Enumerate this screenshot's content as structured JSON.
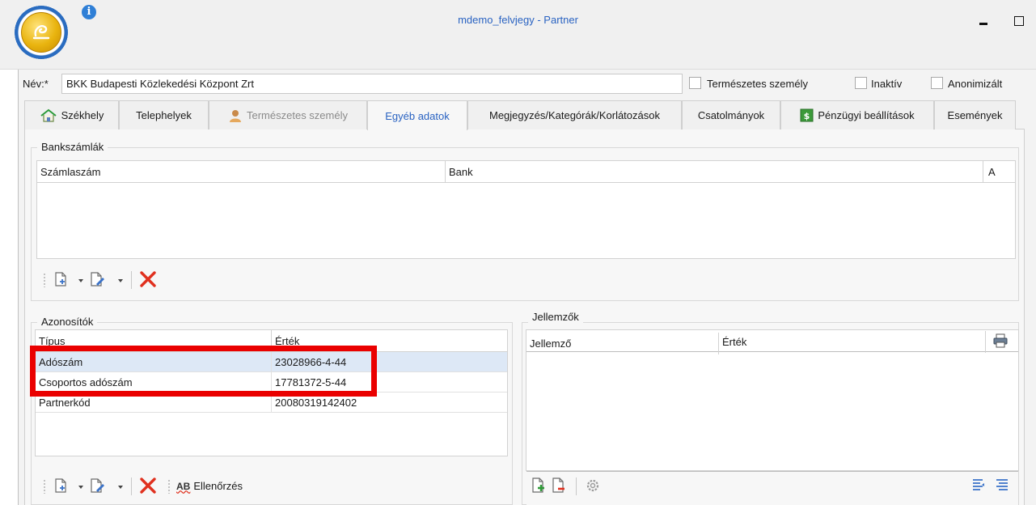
{
  "window": {
    "title": "mdemo_felvjegy - Partner"
  },
  "form": {
    "name_label": "Név:*",
    "name_value": "BKK Budapesti Közlekedési Központ Zrt",
    "natural_person_label": "Természetes személy",
    "inactive_label": "Inaktív",
    "anonymized_label": "Anonimizált"
  },
  "tabs": [
    {
      "label": "Székhely",
      "icon": "home-icon",
      "state": "normal"
    },
    {
      "label": "Telephelyek",
      "icon": "",
      "state": "normal"
    },
    {
      "label": "Természetes személy",
      "icon": "person-icon",
      "state": "disabled"
    },
    {
      "label": "Egyéb adatok",
      "icon": "",
      "state": "active"
    },
    {
      "label": "Megjegyzés/Kategórák/Korlátozások",
      "icon": "",
      "state": "normal"
    },
    {
      "label": "Csatolmányok",
      "icon": "",
      "state": "normal"
    },
    {
      "label": "Pénzügyi beállítások",
      "icon": "money-icon",
      "state": "normal"
    },
    {
      "label": "Események",
      "icon": "",
      "state": "normal"
    }
  ],
  "bank_accounts": {
    "title": "Bankszámlák",
    "columns": [
      "Számlaszám",
      "Bank",
      "A"
    ]
  },
  "identifiers": {
    "title": "Azonosítók",
    "columns": [
      "Típus",
      "Érték"
    ],
    "rows": [
      {
        "type": "Adószám",
        "value": "23028966-4-44"
      },
      {
        "type": "Csoportos adószám",
        "value": "17781372-5-44"
      },
      {
        "type": "Partnerkód",
        "value": "20080319142402"
      }
    ],
    "check_label": "Ellenőrzés",
    "check_icon_text": "AB"
  },
  "attributes": {
    "title": "Jellemzők",
    "columns": [
      "Jellemző",
      "Érték"
    ]
  },
  "colors": {
    "accent": "#2a63c2",
    "highlight": "#ea0000",
    "delete": "#e0301e"
  }
}
